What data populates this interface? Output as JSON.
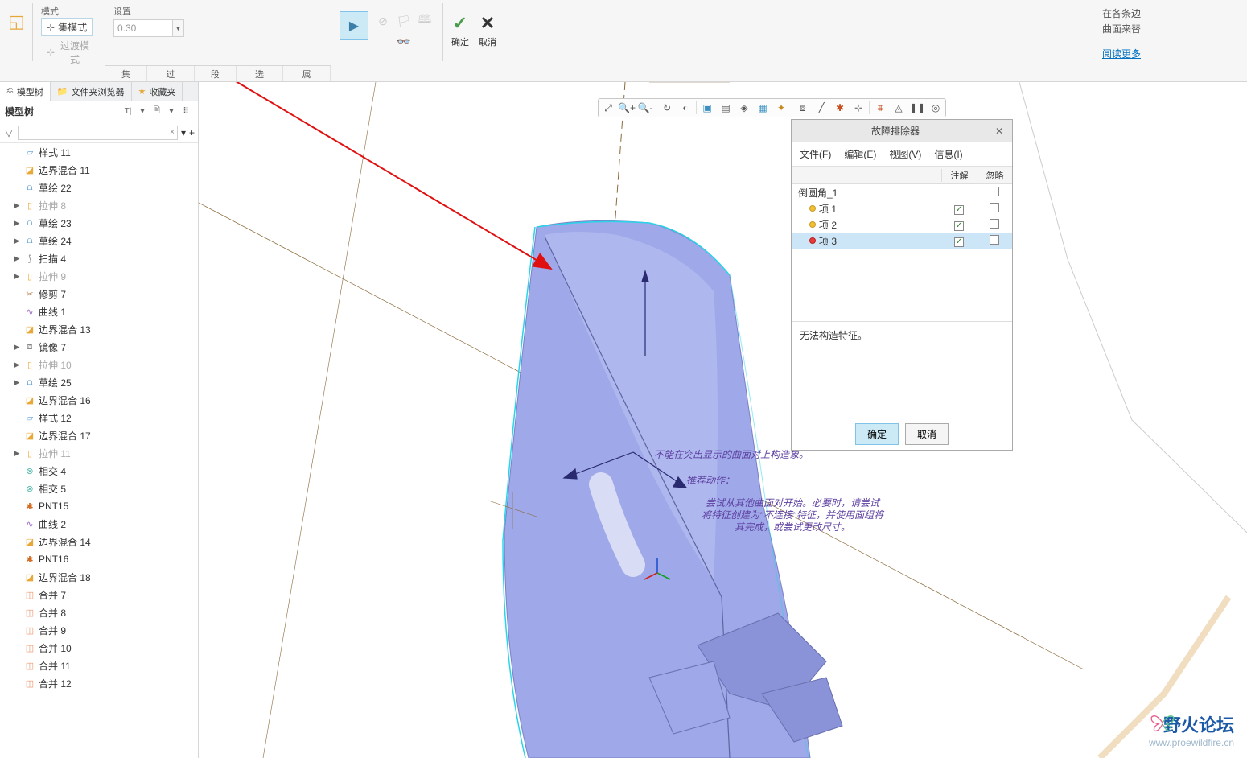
{
  "ribbon": {
    "mode_label": "模式",
    "mode_set": "集模式",
    "mode_trans": "过渡模式",
    "setting_label": "设置",
    "setting_value": "0.30",
    "subtabs": [
      "集",
      "过渡",
      "段",
      "选项",
      "属性"
    ],
    "ok": "确定",
    "cancel": "取消",
    "info1": "在各条边",
    "info2": "曲面来替",
    "read_more": "阅读更多"
  },
  "left": {
    "tabs": {
      "tree": "模型树",
      "folder": "文件夹浏览器",
      "fav": "收藏夹"
    },
    "header": "模型树",
    "items": [
      {
        "icon": "pattern",
        "exp": "",
        "text": "样式 11",
        "dim": false
      },
      {
        "icon": "bound",
        "exp": "",
        "text": "边界混合 11",
        "dim": false
      },
      {
        "icon": "sketch",
        "exp": "",
        "text": "草绘 22",
        "dim": false
      },
      {
        "icon": "extrude",
        "exp": "▶",
        "text": "拉伸 8",
        "dim": true
      },
      {
        "icon": "sketch",
        "exp": "▶",
        "text": "草绘 23",
        "dim": false
      },
      {
        "icon": "sketch",
        "exp": "▶",
        "text": "草绘 24",
        "dim": false
      },
      {
        "icon": "sweep",
        "exp": "▶",
        "text": "扫描 4",
        "dim": false
      },
      {
        "icon": "extrude",
        "exp": "▶",
        "text": "拉伸 9",
        "dim": true
      },
      {
        "icon": "trim",
        "exp": "",
        "text": "修剪 7",
        "dim": false
      },
      {
        "icon": "curve",
        "exp": "",
        "text": "曲线 1",
        "dim": false
      },
      {
        "icon": "bound",
        "exp": "",
        "text": "边界混合 13",
        "dim": false
      },
      {
        "icon": "mirror",
        "exp": "▶",
        "text": "镜像 7",
        "dim": false
      },
      {
        "icon": "extrude",
        "exp": "▶",
        "text": "拉伸 10",
        "dim": true
      },
      {
        "icon": "sketch",
        "exp": "▶",
        "text": "草绘 25",
        "dim": false
      },
      {
        "icon": "bound",
        "exp": "",
        "text": "边界混合 16",
        "dim": false
      },
      {
        "icon": "pattern",
        "exp": "",
        "text": "样式 12",
        "dim": false
      },
      {
        "icon": "bound",
        "exp": "",
        "text": "边界混合 17",
        "dim": false
      },
      {
        "icon": "extrude",
        "exp": "▶",
        "text": "拉伸 11",
        "dim": true
      },
      {
        "icon": "intersect",
        "exp": "",
        "text": "相交 4",
        "dim": false
      },
      {
        "icon": "intersect",
        "exp": "",
        "text": "相交 5",
        "dim": false
      },
      {
        "icon": "pnt",
        "exp": "",
        "text": "PNT15",
        "dim": false
      },
      {
        "icon": "curve",
        "exp": "",
        "text": "曲线 2",
        "dim": false
      },
      {
        "icon": "bound",
        "exp": "",
        "text": "边界混合 14",
        "dim": false
      },
      {
        "icon": "pnt",
        "exp": "",
        "text": "PNT16",
        "dim": false
      },
      {
        "icon": "bound",
        "exp": "",
        "text": "边界混合 18",
        "dim": false
      },
      {
        "icon": "merge",
        "exp": "",
        "text": "合并 7",
        "dim": false
      },
      {
        "icon": "merge",
        "exp": "",
        "text": "合并 8",
        "dim": false
      },
      {
        "icon": "merge",
        "exp": "",
        "text": "合并 9",
        "dim": false
      },
      {
        "icon": "merge",
        "exp": "",
        "text": "合并 10",
        "dim": false
      },
      {
        "icon": "merge",
        "exp": "",
        "text": "合并 11",
        "dim": false
      },
      {
        "icon": "merge",
        "exp": "",
        "text": "合并 12",
        "dim": false
      }
    ]
  },
  "dialog": {
    "title": "故障排除器",
    "menu": [
      "文件(F)",
      "编辑(E)",
      "视图(V)",
      "信息(I)"
    ],
    "col_note": "注解",
    "col_ignore": "忽略",
    "root": "倒圆角_1",
    "rows": [
      {
        "dot": "y",
        "name": "项 1",
        "note": true,
        "ignore": false,
        "sel": false
      },
      {
        "dot": "y",
        "name": "项 2",
        "note": true,
        "ignore": false,
        "sel": false
      },
      {
        "dot": "r",
        "name": "项 3",
        "note": true,
        "ignore": false,
        "sel": true
      }
    ],
    "message": "无法构造特征。",
    "ok": "确定",
    "cancel": "取消"
  },
  "canvas_hint": {
    "line1": "不能在突出显示的曲面对上构造象。",
    "line2": "推荐动作：",
    "line3": "尝试从其他曲面对开始。必要时，请尝试",
    "line4": "将特征创建为\"不连接\"特征，并使用面组将",
    "line5": "其完成，或尝试更改尺寸。"
  },
  "watermark": {
    "name": "野火论坛",
    "url": "www.proewildfire.cn"
  }
}
